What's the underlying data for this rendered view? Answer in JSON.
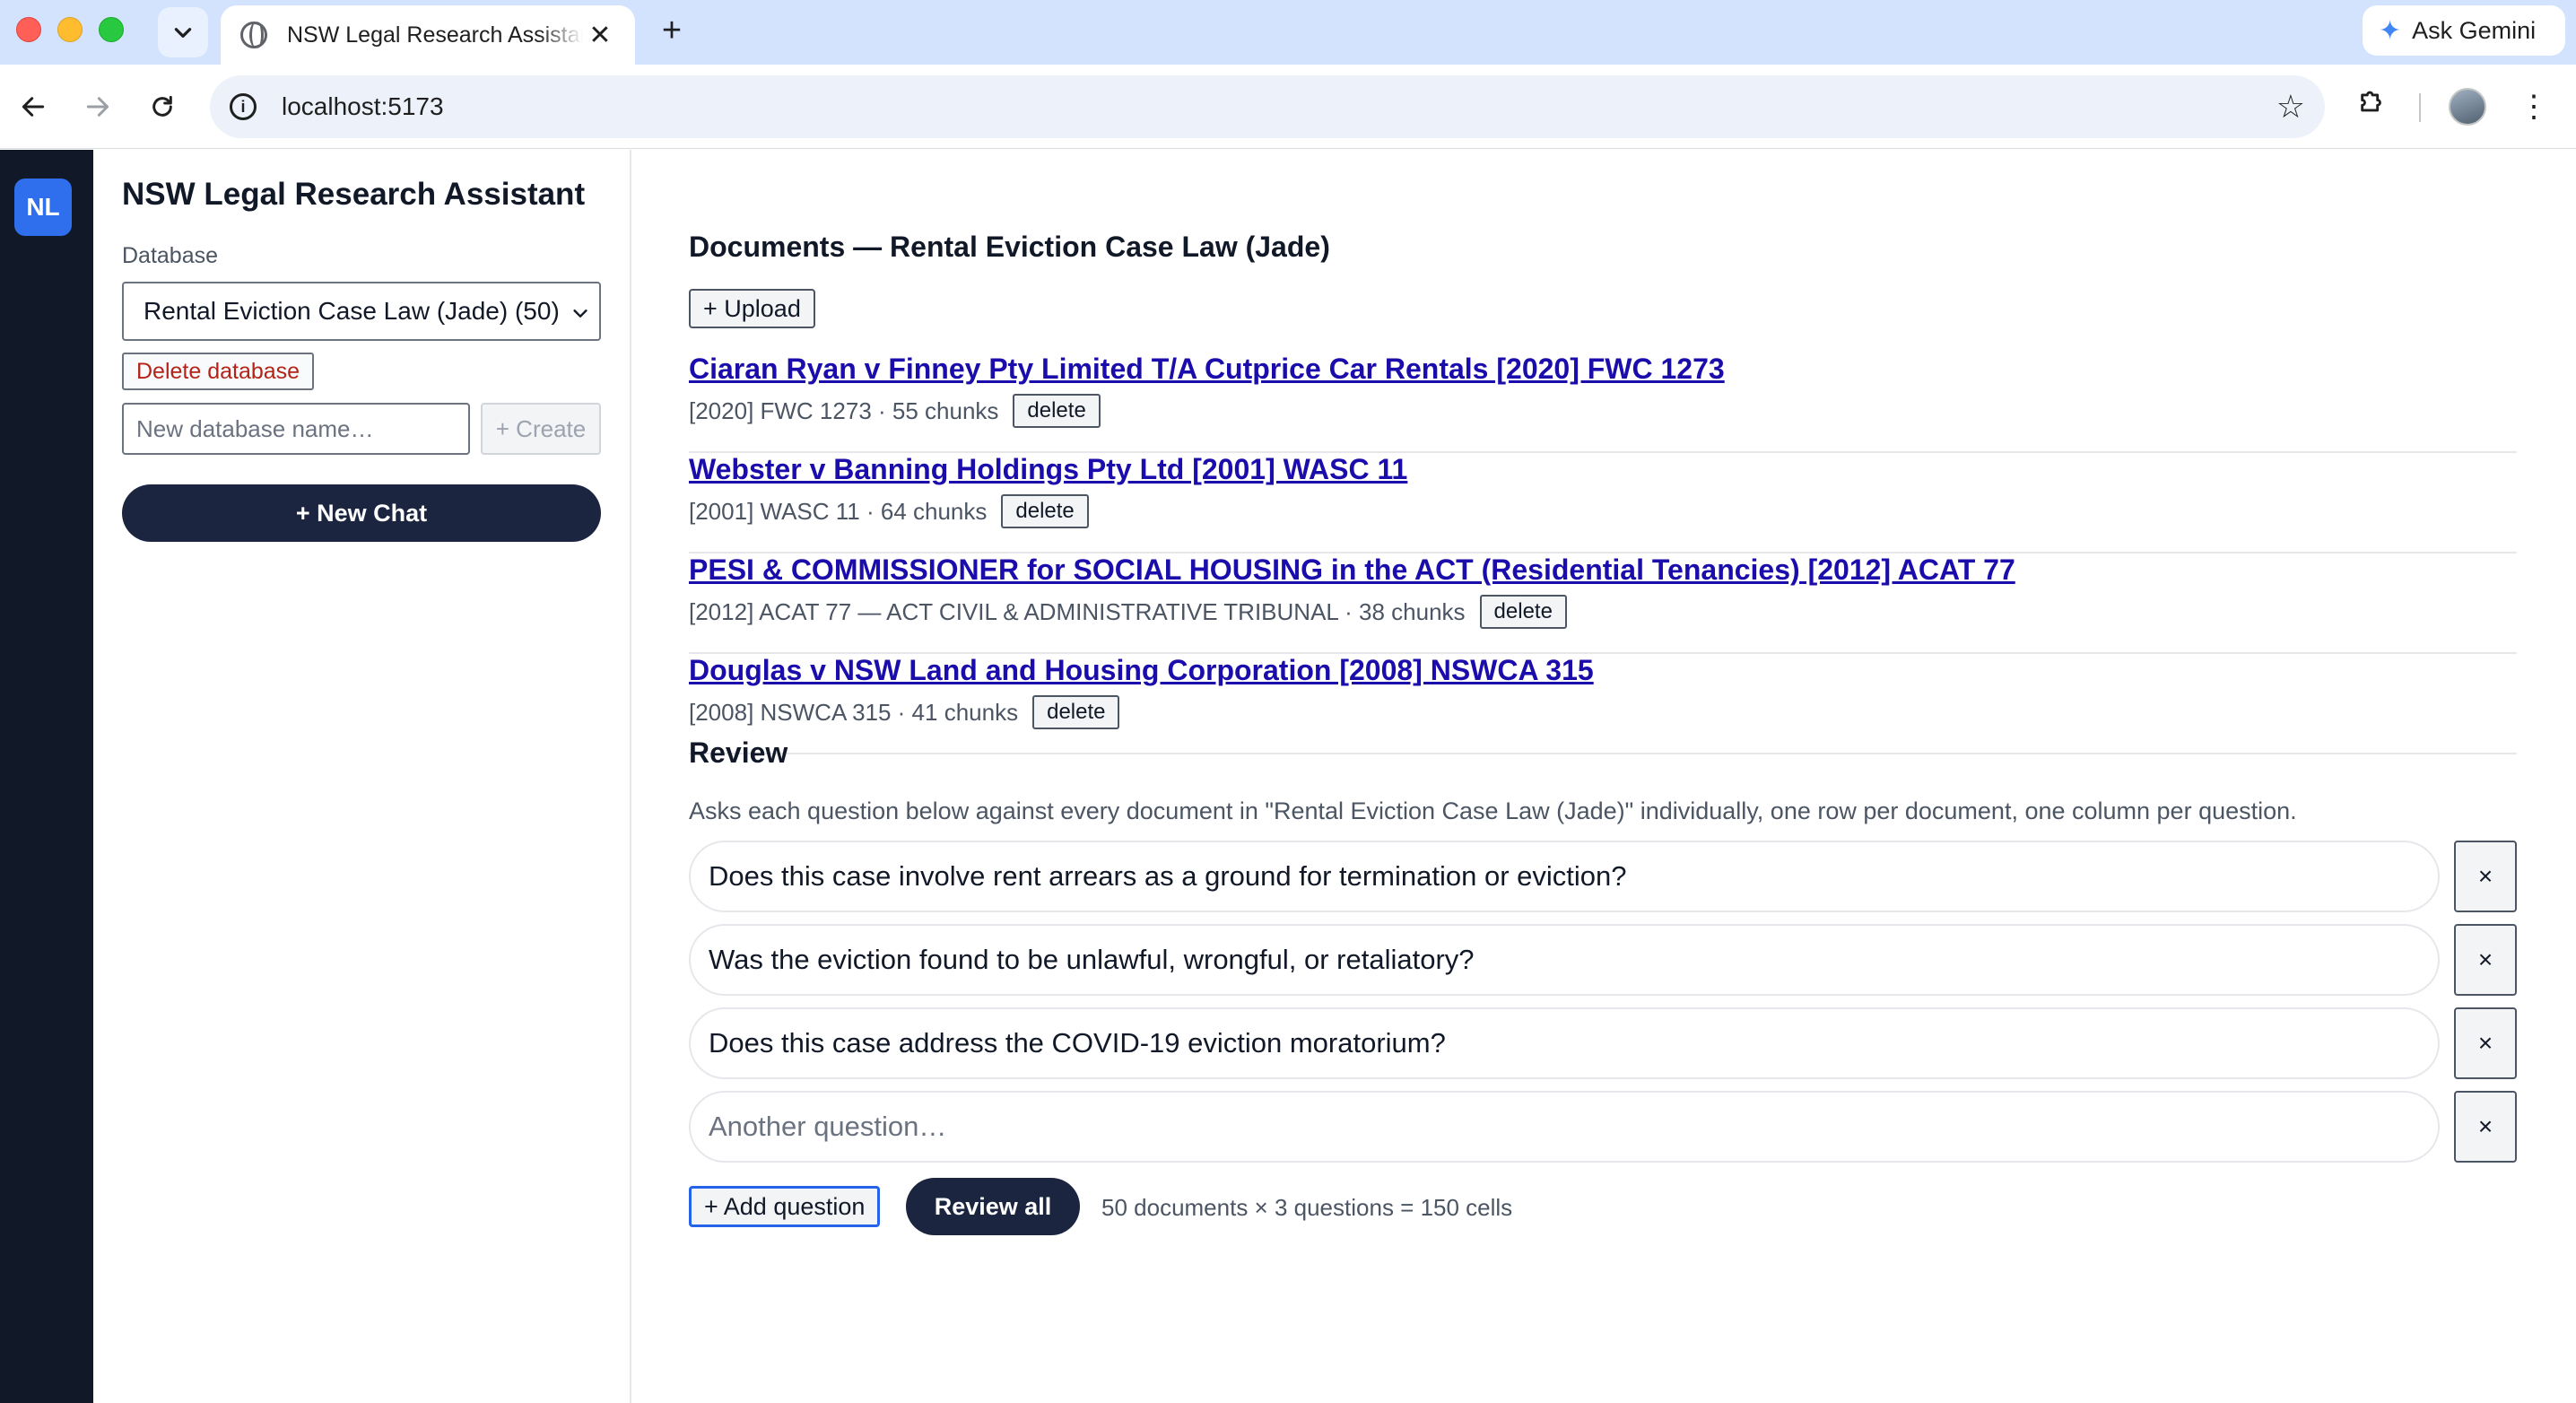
{
  "browser": {
    "tab_title": "NSW Legal Research Assistant",
    "url": "localhost:5173",
    "gemini_label": "Ask Gemini",
    "icons": {
      "tab_search": "chevron-down-icon",
      "favicon": "globe-icon",
      "close_tab": "close-icon",
      "new_tab": "plus-icon",
      "back": "arrow-left-icon",
      "forward": "arrow-right-icon",
      "reload": "reload-icon",
      "site_info": "info-icon",
      "bookmark": "star-icon",
      "extensions": "puzzle-icon",
      "menu": "kebab-icon"
    }
  },
  "rail": {
    "badge": "NL"
  },
  "sidebar": {
    "title": "NSW Legal Research Assistant",
    "database_label": "Database",
    "database_selected": "Rental Eviction Case Law (Jade) (50)",
    "delete_database_label": "Delete database",
    "new_database_placeholder": "New database name…",
    "create_label": "+ Create",
    "new_chat_label": "+ New Chat"
  },
  "documents": {
    "heading": "Documents — Rental Eviction Case Law (Jade)",
    "upload_label": "+ Upload",
    "delete_label": "delete",
    "items": [
      {
        "title": "Ciaran Ryan v Finney Pty Limited T/A Cutprice Car Rentals [2020] FWC 1273",
        "meta": "[2020] FWC 1273 · 55 chunks"
      },
      {
        "title": "Webster v Banning Holdings Pty Ltd [2001] WASC 11",
        "meta": "[2001] WASC 11 · 64 chunks"
      },
      {
        "title": "PESI & COMMISSIONER for SOCIAL HOUSING in the ACT (Residential Tenancies) [2012] ACAT 77",
        "meta": "[2012] ACAT 77 — ACT CIVIL & ADMINISTRATIVE TRIBUNAL · 38 chunks"
      },
      {
        "title": "Douglas v NSW Land and Housing Corporation [2008] NSWCA 315",
        "meta": "[2008] NSWCA 315 · 41 chunks"
      }
    ]
  },
  "review": {
    "heading": "Review",
    "description": "Asks each question below against every document in \"Rental Eviction Case Law (Jade)\" individually, one row per document, one column per question.",
    "remove_label": "×",
    "questions": [
      "Does this case involve rent arrears as a ground for termination or eviction?",
      "Was the eviction found to be unlawful, wrongful, or retaliatory?",
      "Does this case address the COVID-19 eviction moratorium?"
    ],
    "new_question_placeholder": "Another question…",
    "add_question_label": "+ Add question",
    "review_all_label": "Review all",
    "cells_summary": "50 documents × 3 questions = 150 cells"
  },
  "colors": {
    "rail_bg": "#111827",
    "badge_bg": "#2f6fed",
    "primary_button": "#1b2540",
    "link": "#1a0dab",
    "danger_text": "#b42318",
    "focus_ring": "#2563eb"
  }
}
